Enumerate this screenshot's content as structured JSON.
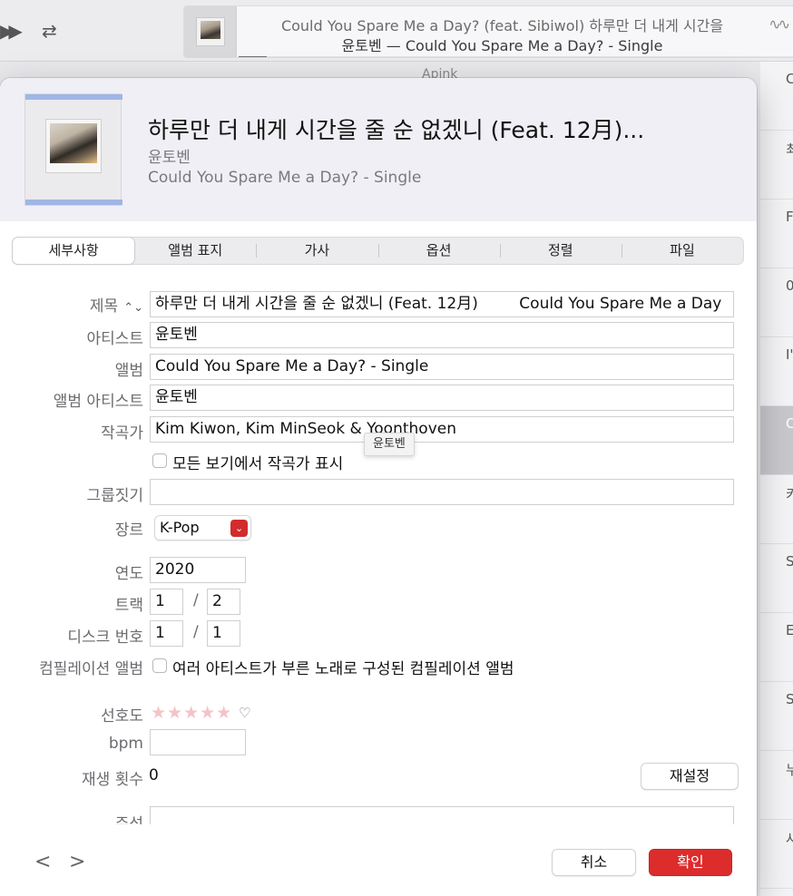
{
  "player": {
    "now_playing_line1": "Could You Spare Me a Day? (feat. Sibiwol)   하루만 더 내게 시간을",
    "now_playing_line2": "윤토벤 — Could You Spare Me a Day? - Single",
    "progress": 0.05
  },
  "background": {
    "column_title": "Apink",
    "rows": [
      "C",
      "최",
      "F",
      "0",
      "I'",
      "C",
      "키",
      "S",
      "E",
      "S",
      "누",
      "사"
    ],
    "selected_index": 5
  },
  "dialog": {
    "header": {
      "title": "하루만 더 내게 시간을 줄 순 없겠니 (Feat. 12月)...",
      "artist": "윤토벤",
      "album": "Could You Spare Me a Day? - Single"
    },
    "tabs": [
      "세부사항",
      "앨범 표지",
      "가사",
      "옵션",
      "정렬",
      "파일"
    ],
    "active_tab": 0,
    "fields": {
      "title_label": "제목",
      "title_value": "하루만 더 내게 시간을 줄 순 없겠니 (Feat. 12月)",
      "title_sort_value": "Could You Spare Me a Day",
      "artist_label": "아티스트",
      "artist_value": "윤토벤",
      "album_label": "앨범",
      "album_value": "Could You Spare Me a Day? - Single",
      "album_artist_label": "앨범 아티스트",
      "album_artist_value": "윤토벤",
      "composer_label": "작곡가",
      "composer_value": "Kim Kiwon, Kim MinSeok & Yoonthoven",
      "show_composer_label": "모든 보기에서 작곡가 표시",
      "tooltip": "윤토벤",
      "grouping_label": "그룹짓기",
      "grouping_value": "",
      "genre_label": "장르",
      "genre_value": "K-Pop",
      "year_label": "연도",
      "year_value": "2020",
      "track_label": "트랙",
      "track_number": "1",
      "track_total": "2",
      "disc_label": "디스크 번호",
      "disc_number": "1",
      "disc_total": "1",
      "compilation_label": "컴필레이션 앨범",
      "compilation_checkbox_label": "여러 아티스트가 부른 노래로 구성된 컴필레이션 앨범",
      "rating_label": "선호도",
      "rating_stars": "★★★★★",
      "rating_value": 0,
      "bpm_label": "bpm",
      "bpm_value": "",
      "play_count_label": "재생 횟수",
      "play_count_value": "0",
      "reset_button": "재설정",
      "comments_label": "주석"
    },
    "footer": {
      "prev": "<",
      "next": ">",
      "cancel_button": "취소",
      "ok_button": "확인"
    }
  },
  "colors": {
    "accent": "#dd2c2c",
    "header_bg": "#f0eff5",
    "star_empty": "#f4c3c7"
  }
}
